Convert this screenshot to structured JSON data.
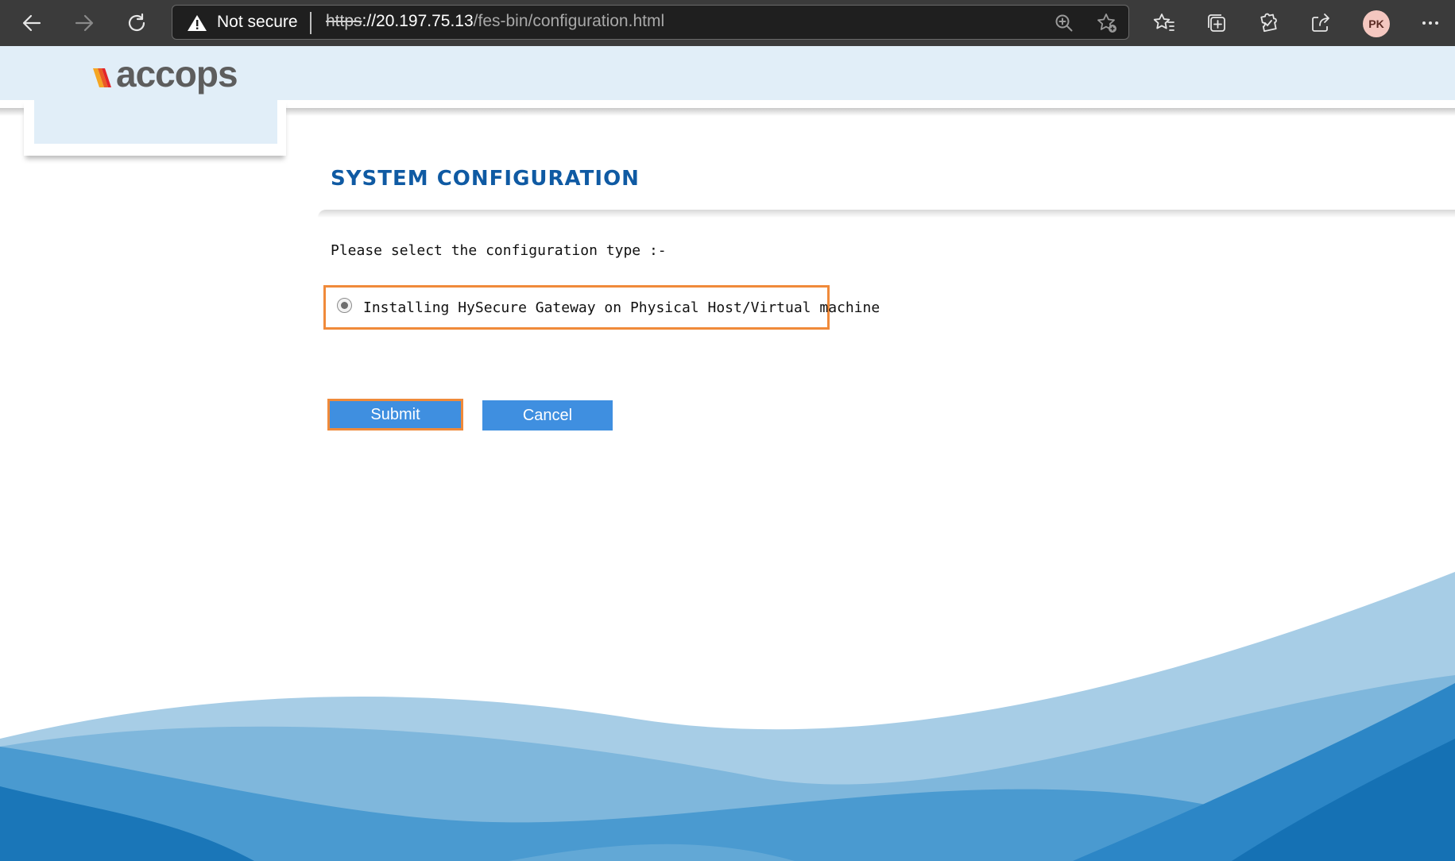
{
  "browser": {
    "security_label": "Not secure",
    "url_scheme": "https",
    "url_host": "://20.197.75.13",
    "url_path": "/fes-bin/configuration.html",
    "profile_initials": "PK",
    "icons": [
      "back-arrow-icon",
      "forward-arrow-icon",
      "refresh-icon",
      "warning-icon",
      "zoom-icon",
      "add-favorite-icon",
      "favorites-icon",
      "collections-icon",
      "extensions-icon",
      "share-icon",
      "more-icon"
    ]
  },
  "brand": {
    "logo_text": "accops",
    "colors": {
      "header_band": "#e1eef8",
      "title": "#0f5aa3",
      "button": "#3f8fe0",
      "highlight": "#f08a3a"
    }
  },
  "page": {
    "title": "SYSTEM CONFIGURATION",
    "prompt": "Please select the configuration type :-",
    "option_label": "Installing HySecure Gateway on Physical Host/Virtual machine",
    "option_selected": true,
    "submit_label": "Submit",
    "cancel_label": "Cancel"
  }
}
